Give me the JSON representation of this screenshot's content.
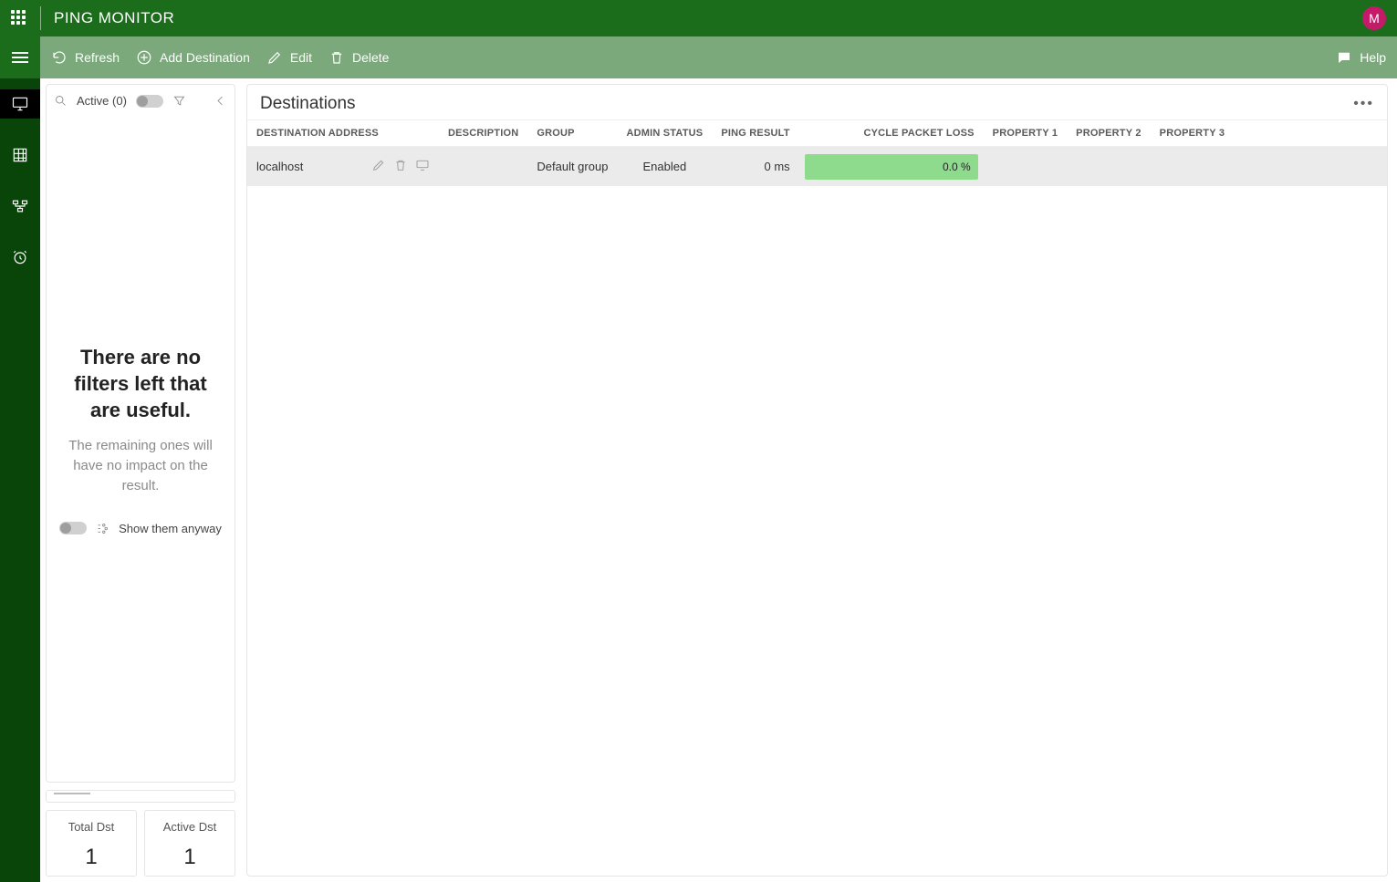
{
  "titlebar": {
    "title": "PING MONITOR",
    "avatar_initial": "M"
  },
  "toolbar": {
    "refresh": "Refresh",
    "add": "Add Destination",
    "edit": "Edit",
    "delete": "Delete",
    "help": "Help"
  },
  "filters": {
    "active_label": "Active (0)",
    "empty_heading": "There are no filters left that are useful.",
    "empty_sub": "The remaining ones will have no impact on the result.",
    "show_anyway": "Show them anyway"
  },
  "stats": {
    "total_label": "Total Dst",
    "total_value": "1",
    "active_label": "Active Dst",
    "active_value": "1"
  },
  "content": {
    "title": "Destinations",
    "columns": {
      "dest": "DESTINATION ADDRESS",
      "desc": "DESCRIPTION",
      "group": "GROUP",
      "admin": "ADMIN STATUS",
      "ping": "PING RESULT",
      "loss": "CYCLE PACKET LOSS",
      "p1": "PROPERTY 1",
      "p2": "PROPERTY 2",
      "p3": "PROPERTY 3"
    },
    "rows": [
      {
        "dest": "localhost",
        "desc": "",
        "group": "Default group",
        "admin": "Enabled",
        "ping": "0 ms",
        "loss": "0.0 %",
        "p1": "",
        "p2": "",
        "p3": ""
      }
    ]
  }
}
